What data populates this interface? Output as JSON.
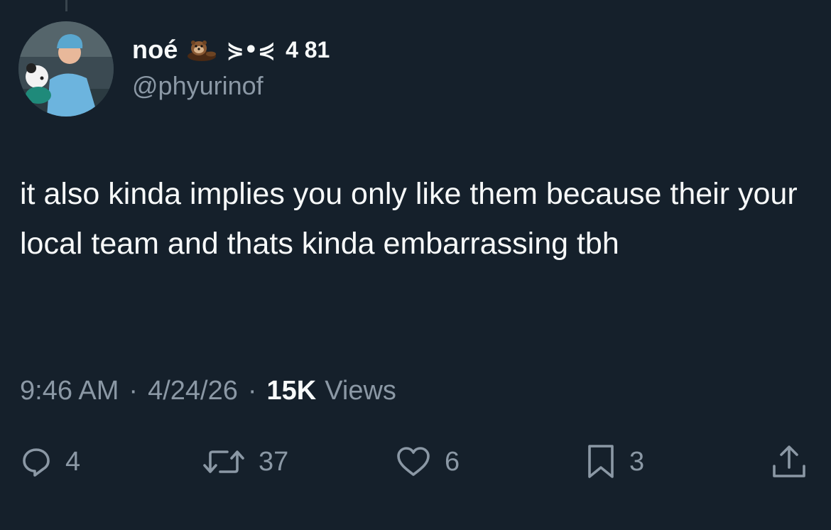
{
  "author": {
    "display_name": "noé",
    "name_emoji_icon": "otter-icon",
    "name_kaomoji": "⋟•⋞",
    "name_numbers": "4 81",
    "handle": "@phyurinof",
    "avatar": "avatar-hockey-player-with-plush"
  },
  "tweet": {
    "text": "it also kinda implies you only like them because their your local team and thats kinda embarrassing tbh"
  },
  "meta": {
    "time": "9:46 AM",
    "separator": "·",
    "date": "4/24/26",
    "views_count": "15K",
    "views_label": "Views"
  },
  "actions": {
    "reply": {
      "icon": "reply-icon",
      "count": "4"
    },
    "repost": {
      "icon": "repost-icon",
      "count": "37"
    },
    "like": {
      "icon": "heart-icon",
      "count": "6"
    },
    "bookmark": {
      "icon": "bookmark-icon",
      "count": "3"
    },
    "share": {
      "icon": "share-icon"
    }
  },
  "colors": {
    "background": "#15202b",
    "primary_text": "#f7f9f9",
    "secondary_text": "#8b98a5"
  }
}
